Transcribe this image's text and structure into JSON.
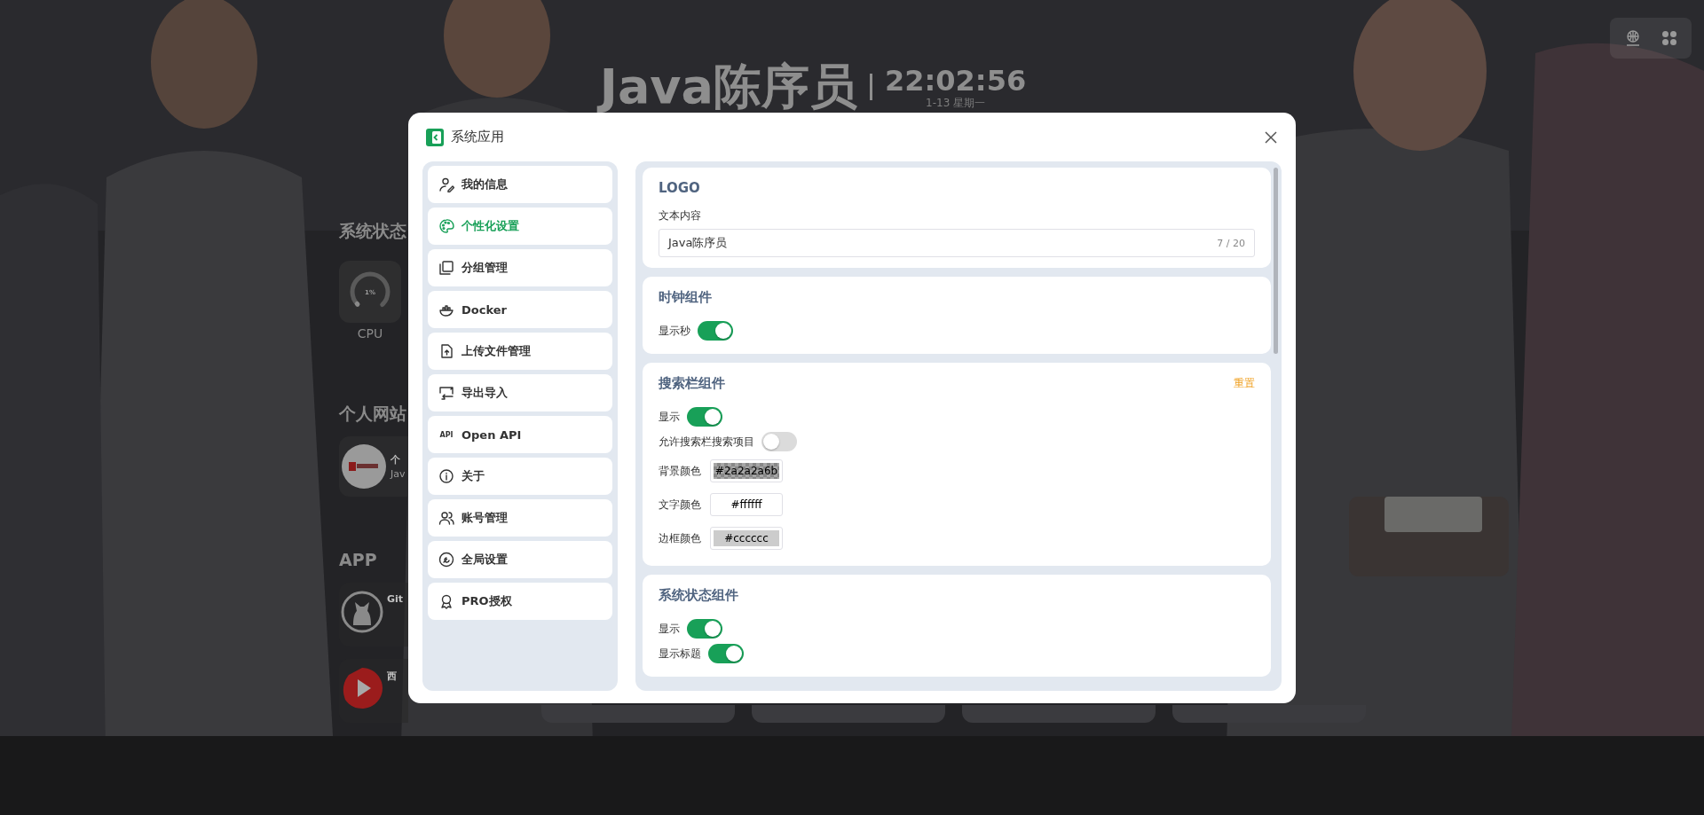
{
  "header": {
    "logo_text": "Java陈序员",
    "time": "22:02:56",
    "date": "1-13 星期一"
  },
  "status_widget": {
    "title": "系统状态",
    "cpu": {
      "reading": "1%",
      "level": 0.01,
      "label": "CPU"
    }
  },
  "sites_widget": {
    "title": "个人网站",
    "items": [
      {
        "title": "个",
        "subtitle": "Jav"
      }
    ]
  },
  "apps_widget": {
    "title": "APP",
    "items": [
      {
        "title": "Git"
      },
      {
        "title": "西"
      }
    ]
  },
  "dialog": {
    "title": "系统应用",
    "menu": [
      {
        "label": "我的信息",
        "selected": false
      },
      {
        "label": "个性化设置",
        "selected": true
      },
      {
        "label": "分组管理",
        "selected": false
      },
      {
        "label": "Docker",
        "selected": false
      },
      {
        "label": "上传文件管理",
        "selected": false
      },
      {
        "label": "导出导入",
        "selected": false
      },
      {
        "label": "Open API",
        "selected": false,
        "icon_text": "API"
      },
      {
        "label": "关于",
        "selected": false
      },
      {
        "label": "账号管理",
        "selected": false
      },
      {
        "label": "全局设置",
        "selected": false
      },
      {
        "label": "PRO授权",
        "selected": false
      }
    ],
    "sections": [
      {
        "title": "LOGO",
        "rows": [
          {
            "kind": "text",
            "label": "文本内容",
            "value": "Java陈序员",
            "count": "7 / 20"
          }
        ]
      },
      {
        "title": "时钟组件",
        "rows": [
          {
            "kind": "switch",
            "label": "显示秒",
            "on": true
          }
        ]
      },
      {
        "title": "搜索栏组件",
        "action": "重置",
        "rows": [
          {
            "kind": "switch",
            "label": "显示",
            "on": true
          },
          {
            "kind": "switch",
            "label": "允许搜索栏搜索项目",
            "on": false
          },
          {
            "kind": "color",
            "label": "背景颜色",
            "value": "#2a2a2a6b"
          },
          {
            "kind": "color",
            "label": "文字颜色",
            "value": "#ffffff"
          },
          {
            "kind": "color",
            "label": "边框颜色",
            "value": "#cccccc"
          }
        ]
      },
      {
        "title": "系统状态组件",
        "rows": [
          {
            "kind": "switch",
            "label": "显示",
            "on": true
          },
          {
            "kind": "switch",
            "label": "显示标题",
            "on": true
          }
        ]
      }
    ]
  }
}
